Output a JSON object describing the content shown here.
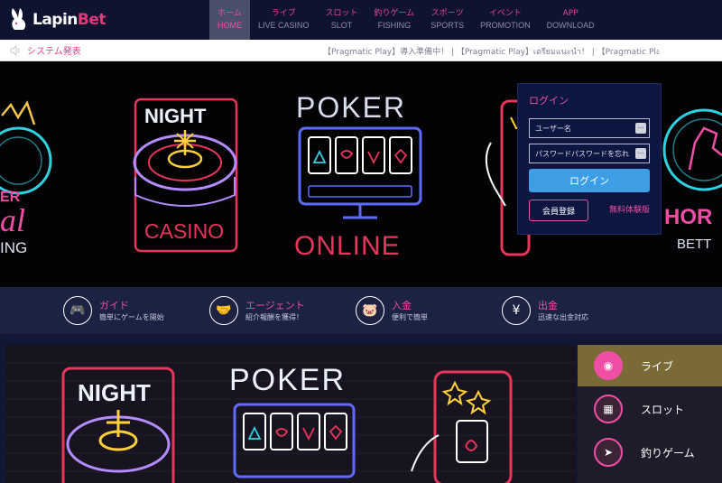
{
  "header": {
    "logo_text_main": "Lapin",
    "logo_text_accent": "Bet",
    "nav": [
      {
        "jp": "ホーム",
        "en": "HOME"
      },
      {
        "jp": "ライブ",
        "en": "LIVE CASINO"
      },
      {
        "jp": "スロット",
        "en": "SLOT"
      },
      {
        "jp": "釣りゲーム",
        "en": "FISHING"
      },
      {
        "jp": "スポーツ",
        "en": "SPORTS"
      },
      {
        "jp": "イベント",
        "en": "PROMOTION"
      },
      {
        "jp": "APP",
        "en": "DOWNLOAD"
      }
    ]
  },
  "announce": {
    "title": "システム発表",
    "ticker": "【Pragmatic Play】導入準備中！ | 【Pragmatic Play】เตรียมแนะนำ！ | 【Pragmatic Play"
  },
  "hero": {
    "neon_night": "NIGHT",
    "neon_casino": "CASINO",
    "neon_poker": "POKER",
    "neon_online": "ONLINE",
    "neon_left_word": "al",
    "neon_left_sub": "ING",
    "neon_left_top": "ER",
    "neon_right_word": "HOR",
    "neon_right_sub": "BETT"
  },
  "login": {
    "title": "ログイン",
    "username_placeholder": "ユーザー名",
    "password_placeholder": "パスワードパスワードを忘れた？",
    "login_button": "ログイン",
    "register_button": "会員登録",
    "trial_link": "無料体験版"
  },
  "features": [
    {
      "icon": "gamepad-icon",
      "glyph": "🎮",
      "title": "ガイド",
      "desc": "簡単にゲームを開始"
    },
    {
      "icon": "handshake-icon",
      "glyph": "🤝",
      "title": "エージェント",
      "desc": "紹介報酬を獲得！"
    },
    {
      "icon": "piggy-bank-icon",
      "glyph": "🐷",
      "title": "入金",
      "desc": "便利で簡単"
    },
    {
      "icon": "money-bag-icon",
      "glyph": "¥",
      "title": "出金",
      "desc": "迅速な出金対応"
    }
  ],
  "bottom": {
    "neon_night": "NIGHT",
    "neon_poker": "POKER"
  },
  "categories": [
    {
      "label": "ライブ",
      "icon": "poker-chip-icon",
      "glyph": "◉"
    },
    {
      "label": "スロット",
      "icon": "slot-machine-icon",
      "glyph": "▦"
    },
    {
      "label": "釣りゲーム",
      "icon": "fish-icon",
      "glyph": "➤"
    }
  ],
  "colors": {
    "accent": "#f04ea4",
    "header_bg": "#0e1430",
    "login_button": "#3d9ee6",
    "category_active": "#7a6a38"
  }
}
